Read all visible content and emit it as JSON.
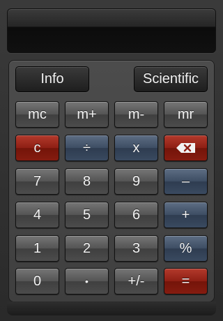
{
  "display": {
    "value": ""
  },
  "top_buttons": {
    "info": "Info",
    "scientific": "Scientific"
  },
  "memory": {
    "mc": "mc",
    "mplus": "m+",
    "mminus": "m-",
    "mr": "mr"
  },
  "ops": {
    "clear": "c",
    "divide": "÷",
    "multiply": "x",
    "minus": "–",
    "plus": "+",
    "percent": "%",
    "sign": "+/-",
    "equals": "=",
    "decimal": "•"
  },
  "digits": {
    "d0": "0",
    "d1": "1",
    "d2": "2",
    "d3": "3",
    "d4": "4",
    "d5": "5",
    "d6": "6",
    "d7": "7",
    "d8": "8",
    "d9": "9"
  },
  "icons": {
    "backspace": "backspace-icon"
  },
  "colors": {
    "gray": "#545454",
    "blue": "#3d4d63",
    "red": "#8e1f14"
  }
}
